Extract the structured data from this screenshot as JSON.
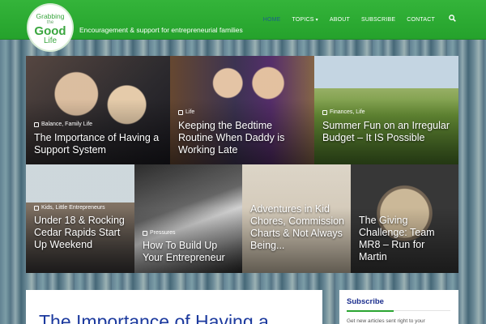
{
  "brand": {
    "logo_line1": "Grabbing",
    "logo_line2": "the",
    "logo_line3": "Good",
    "logo_line4": "Life",
    "tagline": "Encouragement & support for entrepreneurial families",
    "color": "#2aa531"
  },
  "nav": {
    "items": [
      "HOME",
      "TOPICS",
      "ABOUT",
      "SUBSCRIBE",
      "CONTACT"
    ],
    "active": "HOME",
    "search_icon": "search-icon"
  },
  "tiles": [
    {
      "category": "Balance, Family Life",
      "title": "The Importance of Having a Support System"
    },
    {
      "category": "Life",
      "title": "Keeping the Bedtime Routine When Daddy is Working Late"
    },
    {
      "category": "Finances, Life",
      "title": "Summer Fun on an Irregular Budget – It IS Possible"
    },
    {
      "category": "Kids, Little Entrepreneurs",
      "title": "Under 18 & Rocking Cedar Rapids Start Up Weekend"
    },
    {
      "category": "Pressures",
      "title": "How To Build Up Your Entrepreneur"
    },
    {
      "category": "",
      "title": "Adventures in Kid Chores, Commission Charts & Not Always Being..."
    },
    {
      "category": "",
      "title": "The Giving Challenge: Team MR8 – Run for Martin"
    }
  ],
  "article": {
    "heading": "The Importance of Having a"
  },
  "sidebar": {
    "widget_title": "Subscribe",
    "intro": "Get new articles sent right to your"
  }
}
